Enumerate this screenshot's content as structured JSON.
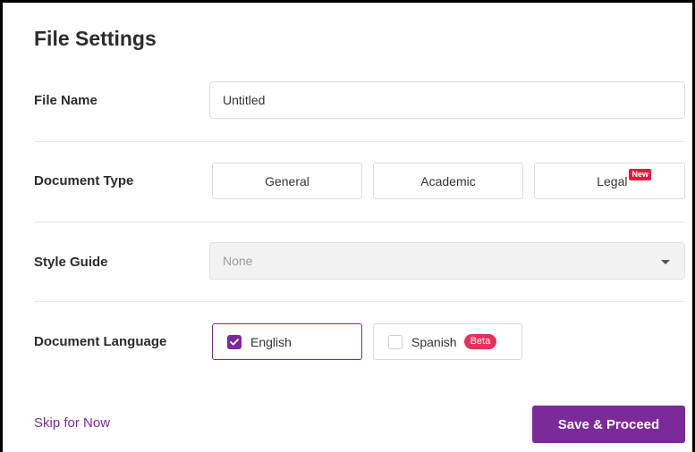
{
  "dialog": {
    "title": "File Settings"
  },
  "file_name": {
    "label": "File Name",
    "value": "Untitled"
  },
  "document_type": {
    "label": "Document Type",
    "options": [
      {
        "label": "General"
      },
      {
        "label": "Academic"
      },
      {
        "label": "Legal",
        "badge": "New"
      }
    ]
  },
  "style_guide": {
    "label": "Style Guide",
    "selected": "None"
  },
  "document_language": {
    "label": "Document Language",
    "options": [
      {
        "label": "English",
        "checked": true
      },
      {
        "label": "Spanish",
        "checked": false,
        "badge": "Beta"
      }
    ]
  },
  "footer": {
    "skip_label": "Skip for Now",
    "save_label": "Save & Proceed"
  },
  "colors": {
    "accent": "#7b2a9a",
    "badge_red": "#e8173e"
  }
}
